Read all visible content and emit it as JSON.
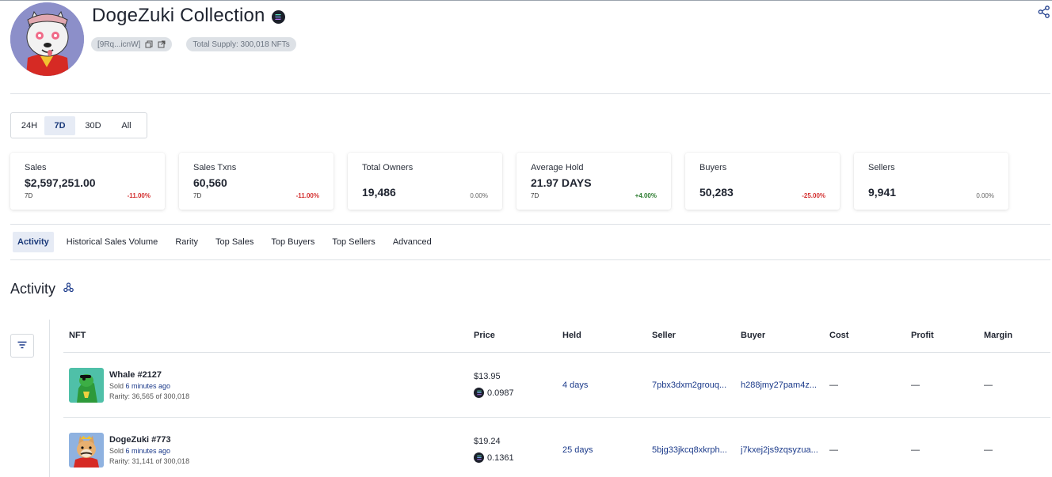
{
  "collection": {
    "title": "DogeZuki Collection",
    "address": "[9Rq...icnW]",
    "total_supply": "Total Supply: 300,018 NFTs"
  },
  "period": {
    "options": [
      "24H",
      "7D",
      "30D",
      "All"
    ],
    "selected": "7D"
  },
  "stats": [
    {
      "label": "Sales",
      "value": "$2,597,251.00",
      "period": "7D",
      "change": "-11.00%"
    },
    {
      "label": "Sales Txns",
      "value": "60,560",
      "period": "7D",
      "change": "-11.00%"
    },
    {
      "label": "Total Owners",
      "value": "19,486",
      "period": "",
      "change": "0.00%"
    },
    {
      "label": "Average Hold",
      "value": "21.97 DAYS",
      "period": "7D",
      "change": "+4.00%"
    },
    {
      "label": "Buyers",
      "value": "50,283",
      "period": "",
      "change": "-25.00%"
    },
    {
      "label": "Sellers",
      "value": "9,941",
      "period": "",
      "change": "0.00%"
    }
  ],
  "tabs": [
    "Activity",
    "Historical Sales Volume",
    "Rarity",
    "Top Sales",
    "Top Buyers",
    "Top Sellers",
    "Advanced"
  ],
  "active_tab": "Activity",
  "section": {
    "title": "Activity"
  },
  "table": {
    "columns": [
      "NFT",
      "Price",
      "Held",
      "Seller",
      "Buyer",
      "Cost",
      "Profit",
      "Margin"
    ],
    "rows": [
      {
        "name": "Whale #2127",
        "sold_prefix": "Sold",
        "sold_time": "6 minutes ago",
        "rarity": "Rarity: 36,565 of 300,018",
        "price_usd": "$13.95",
        "price_sol": "0.0987",
        "held": "4 days",
        "seller": "7pbx3dxm2grouq...",
        "buyer": "h288jmy27pam4z...",
        "cost": "—",
        "profit": "—",
        "margin": "—"
      },
      {
        "name": "DogeZuki #773",
        "sold_prefix": "Sold",
        "sold_time": "6 minutes ago",
        "rarity": "Rarity: 31,141 of 300,018",
        "price_usd": "$19.24",
        "price_sol": "0.1361",
        "held": "25 days",
        "seller": "5bjg33jkcq8xkrph...",
        "buyer": "j7kxej2js9zqsyzua...",
        "cost": "—",
        "profit": "—",
        "margin": "—"
      }
    ]
  },
  "icons": {
    "chain": "solana-icon",
    "copy": "copy-icon",
    "external": "external-link-icon",
    "share": "share-icon",
    "filter": "filter-icon",
    "section": "network-icon"
  },
  "colors": {
    "accent": "#1b3a8a",
    "active_bg": "#e6ebf5",
    "negative": "#d32f2f",
    "positive": "#2e7d32",
    "avatar_bg": "#8c8fc9"
  }
}
